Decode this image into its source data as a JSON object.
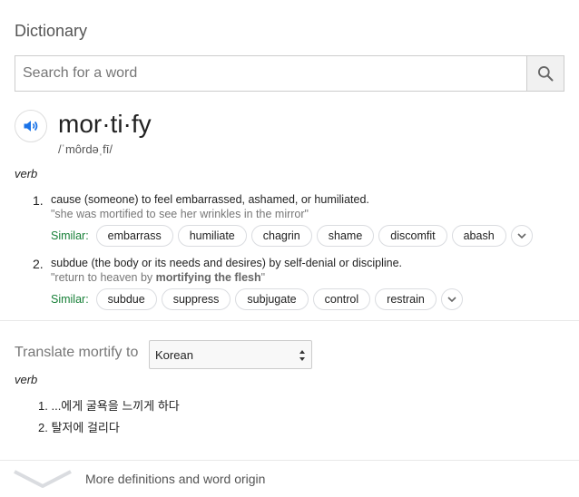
{
  "panel": {
    "title": "Dictionary",
    "search_placeholder": "Search for a word"
  },
  "entry": {
    "headword": "mor·ti·fy",
    "pronunciation": "/ˈmôrdəˌfī/",
    "pos": "verb",
    "similar_label": "Similar:",
    "senses": [
      {
        "num": "1.",
        "definition": "cause (someone) to feel embarrassed, ashamed, or humiliated.",
        "example": "\"she was mortified to see her wrinkles in the mirror\"",
        "similar": [
          "embarrass",
          "humiliate",
          "chagrin",
          "shame",
          "discomfit",
          "abash"
        ]
      },
      {
        "num": "2.",
        "definition": "subdue (the body or its needs and desires) by self-denial or discipline.",
        "example_pre": "\"return to heaven by ",
        "example_bold": "mortifying the flesh",
        "example_post": "\"",
        "similar": [
          "subdue",
          "suppress",
          "subjugate",
          "control",
          "restrain"
        ]
      }
    ]
  },
  "translate": {
    "label": "Translate mortify to",
    "selected_language": "Korean",
    "pos": "verb",
    "items": [
      {
        "num": "1.",
        "text": "...에게 굴욕을 느끼게 하다"
      },
      {
        "num": "2.",
        "text": "탈저에 걸리다"
      }
    ]
  },
  "footer": {
    "more_label": "More definitions and word origin"
  },
  "colors": {
    "similar_label": "#188038",
    "speaker_icon": "#1a73e8",
    "chip_border": "#dadce0"
  },
  "icons": {
    "search": "search-icon",
    "speaker": "speaker-icon",
    "expand": "chevron-down-icon"
  }
}
